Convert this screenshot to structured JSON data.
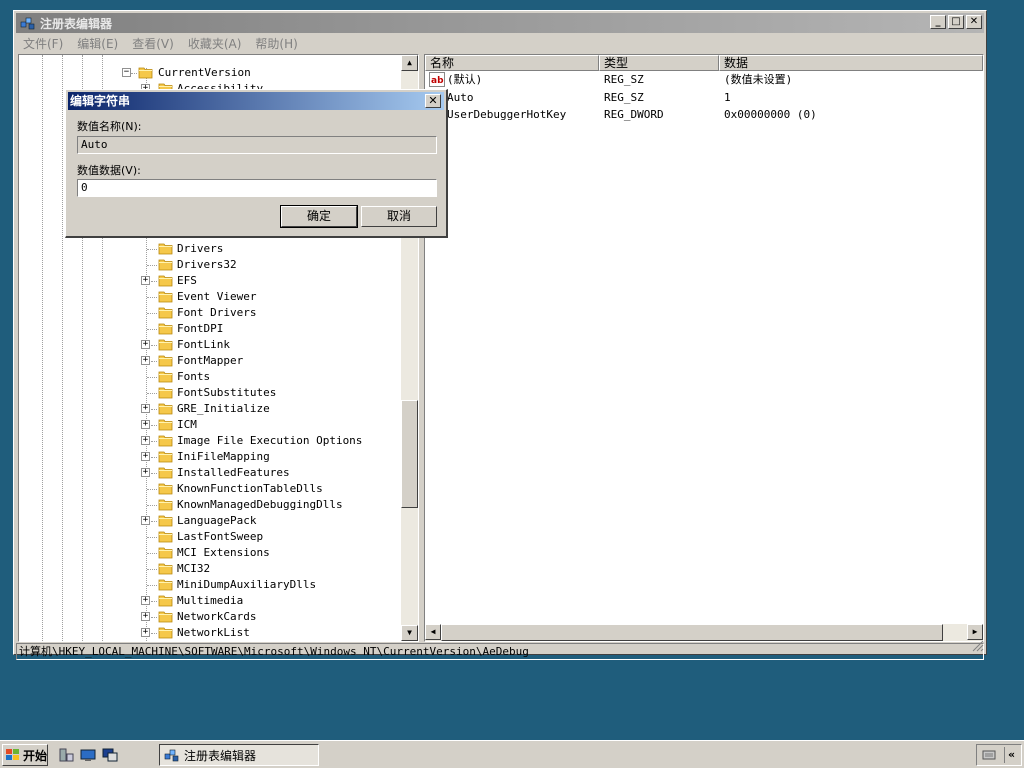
{
  "window": {
    "title": "注册表编辑器",
    "buttons": {
      "minimize": "_",
      "maximize": "□",
      "close": "✕"
    }
  },
  "menu": [
    "文件(F)",
    "编辑(E)",
    "查看(V)",
    "收藏夹(A)",
    "帮助(H)"
  ],
  "tree": {
    "root": "CurrentVersion",
    "items": [
      {
        "label": "Accessibility",
        "expandable": true
      },
      {
        "label": "Drivers",
        "expandable": false
      },
      {
        "label": "Drivers32",
        "expandable": false
      },
      {
        "label": "EFS",
        "expandable": true
      },
      {
        "label": "Event Viewer",
        "expandable": false
      },
      {
        "label": "Font Drivers",
        "expandable": false
      },
      {
        "label": "FontDPI",
        "expandable": false
      },
      {
        "label": "FontLink",
        "expandable": true
      },
      {
        "label": "FontMapper",
        "expandable": true
      },
      {
        "label": "Fonts",
        "expandable": false
      },
      {
        "label": "FontSubstitutes",
        "expandable": false
      },
      {
        "label": "GRE_Initialize",
        "expandable": true
      },
      {
        "label": "ICM",
        "expandable": true
      },
      {
        "label": "Image File Execution Options",
        "expandable": true
      },
      {
        "label": "IniFileMapping",
        "expandable": true
      },
      {
        "label": "InstalledFeatures",
        "expandable": true
      },
      {
        "label": "KnownFunctionTableDlls",
        "expandable": false
      },
      {
        "label": "KnownManagedDebuggingDlls",
        "expandable": false
      },
      {
        "label": "LanguagePack",
        "expandable": true
      },
      {
        "label": "LastFontSweep",
        "expandable": false
      },
      {
        "label": "MCI Extensions",
        "expandable": false
      },
      {
        "label": "MCI32",
        "expandable": false
      },
      {
        "label": "MiniDumpAuxiliaryDlls",
        "expandable": false
      },
      {
        "label": "Multimedia",
        "expandable": true
      },
      {
        "label": "NetworkCards",
        "expandable": true
      },
      {
        "label": "NetworkList",
        "expandable": true
      }
    ],
    "scroll_position": 0.6
  },
  "list": {
    "headers": [
      "名称",
      "类型",
      "数据"
    ],
    "rows": [
      {
        "name": "(默认)",
        "type": "REG_SZ",
        "data": "(数值未设置)",
        "icon": "string-value-icon"
      },
      {
        "name": "Auto",
        "type": "REG_SZ",
        "data": "1",
        "icon": "string-value-icon"
      },
      {
        "name": "UserDebuggerHotKey",
        "type": "REG_DWORD",
        "data": "0x00000000 (0)",
        "icon": "binary-value-icon"
      }
    ]
  },
  "statusbar": {
    "path": "计算机\\HKEY_LOCAL_MACHINE\\SOFTWARE\\Microsoft\\Windows NT\\CurrentVersion\\AeDebug"
  },
  "dialog": {
    "title": "编辑字符串",
    "name_label": "数值名称(N):",
    "name_value": "Auto",
    "data_label": "数值数据(V):",
    "data_value": "0",
    "ok": "确定",
    "cancel": "取消",
    "close": "✕"
  },
  "taskbar": {
    "start": "开始",
    "task": "注册表编辑器"
  },
  "colors": {
    "desktop": "#1f5d7c",
    "face": "#d4d0c8",
    "dialog_title": "#0a246a",
    "folder": "#f5c84a"
  }
}
